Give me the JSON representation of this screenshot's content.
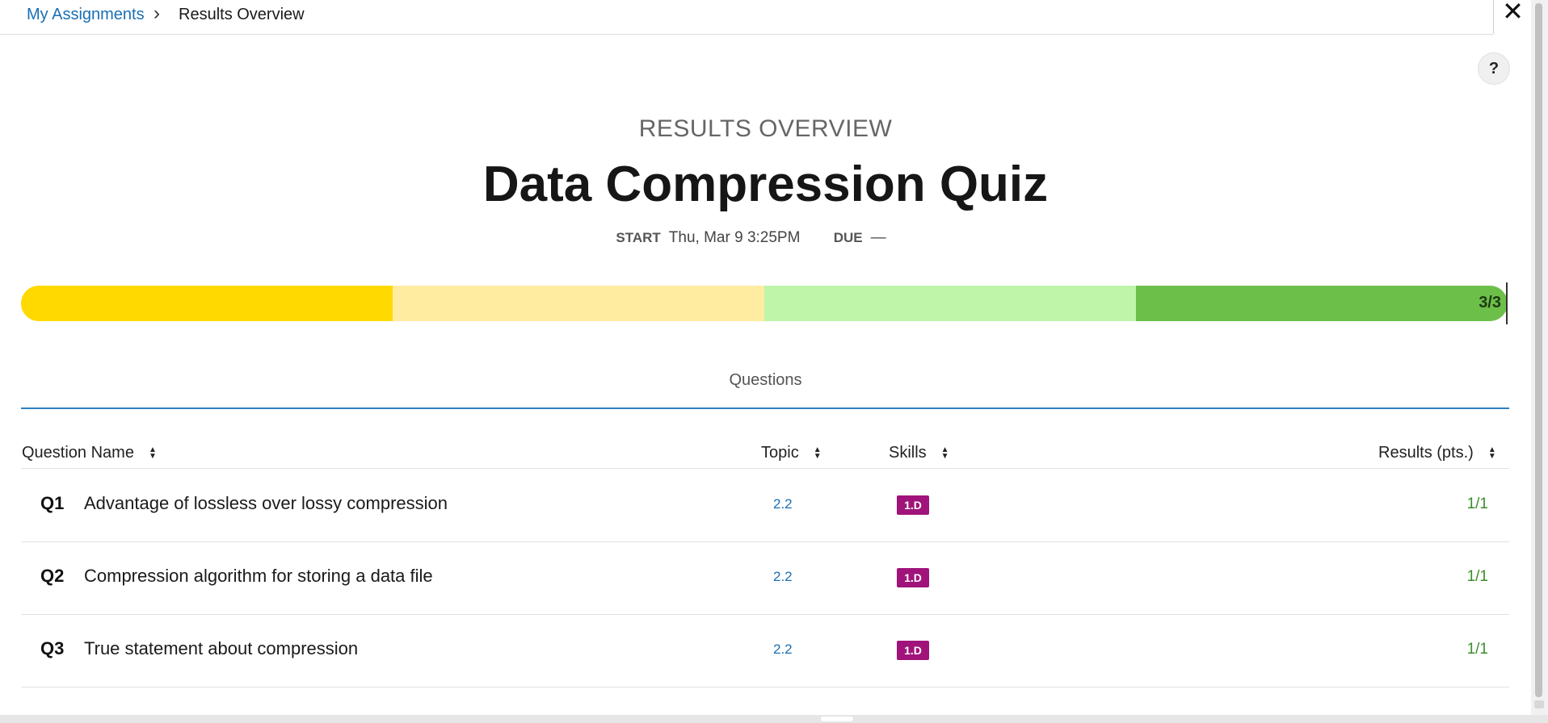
{
  "breadcrumb": {
    "parent": "My Assignments",
    "separator": "›",
    "current": "Results Overview"
  },
  "close_glyph": "✕",
  "help_glyph": "?",
  "header": {
    "eyebrow": "RESULTS OVERVIEW",
    "title": "Data Compression Quiz",
    "start_label": "START",
    "start_value": "Thu, Mar 9 3:25PM",
    "due_label": "DUE",
    "due_value": "—"
  },
  "progress": {
    "label": "3/3",
    "score": 3,
    "total": 3,
    "segment_colors": [
      "#ffd900",
      "#ffeca0",
      "#bff5a8",
      "#6cc04a"
    ]
  },
  "tab": "Questions",
  "table": {
    "columns": [
      "Question Name",
      "Topic",
      "Skills",
      "Results (pts.)"
    ],
    "rows": [
      {
        "num": "Q1",
        "name": "Advantage of lossless over lossy compression",
        "topic": "2.2",
        "skill": "1.D",
        "result": "1/1"
      },
      {
        "num": "Q2",
        "name": "Compression algorithm for storing a data file",
        "topic": "2.2",
        "skill": "1.D",
        "result": "1/1"
      },
      {
        "num": "Q3",
        "name": "True statement about compression",
        "topic": "2.2",
        "skill": "1.D",
        "result": "1/1"
      }
    ]
  },
  "colors": {
    "link": "#1a6fb5",
    "skill_badge": "#a0137a",
    "result_text": "#3a8f2a",
    "tab_underline": "#2f7fc0"
  }
}
